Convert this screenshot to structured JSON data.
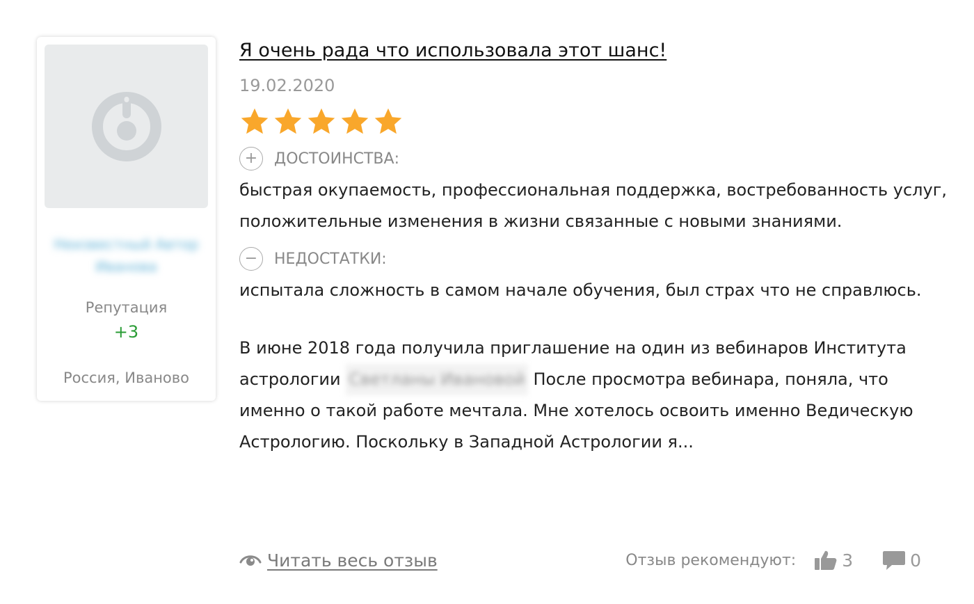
{
  "author": {
    "username_line1": "Неизвестный Автор",
    "username_line2": "Иванова",
    "reputation_label": "Репутация",
    "reputation_value": "+3",
    "location": "Россия, Иваново"
  },
  "review": {
    "title": "Я очень рада что использовала этот шанс!",
    "date": "19.02.2020",
    "rating": 5,
    "rating_max": 5,
    "pros_label": "ДОСТОИНСТВА:",
    "pros_text": "быстрая окупаемость, профессиональная поддержка, востребованность услуг, положительные изменения в жизни связанные с новыми знаниями.",
    "cons_label": "НЕДОСТАТКИ:",
    "cons_text": "испытала сложность в самом начале обучения, был страх что не справлюсь.",
    "text_before": "В июне 2018 года получила приглашение на один из вебинаров Института астрологии ",
    "hidden_name": "Светланы Ивановой",
    "text_after": " После просмотра вебинара, поняла, что именно о такой работе мечтала. Мне хотелось освоить именно Ведическую Астрологию. Поскольку в Западной Астрологии я...",
    "read_more_label": "Читать весь отзыв",
    "recommend_label": "Отзыв рекомендуют:",
    "likes_count": "3",
    "comments_count": "0"
  },
  "colors": {
    "star": "#f9a72b",
    "reputation_positive": "#2a9c35",
    "muted": "#888888"
  },
  "icons": {
    "avatar": "default-avatar-icon",
    "star": "star-icon",
    "plus": "plus-circle-icon",
    "minus": "minus-circle-icon",
    "eye": "eye-icon",
    "thumb": "thumbs-up-icon",
    "comment": "comment-icon"
  }
}
